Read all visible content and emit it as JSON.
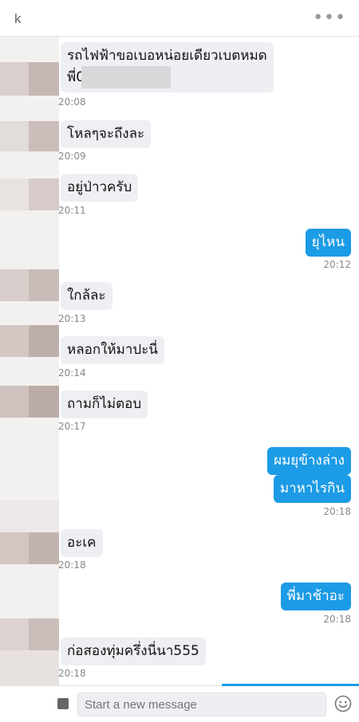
{
  "header": {
    "name": "k",
    "more_icon": "•••"
  },
  "messages": [
    {
      "dir": "in",
      "line1": "รถไฟฟ้าขอเบอหน่อยเดียวเบตหมด",
      "line2": "พี่0",
      "time": "20:08"
    },
    {
      "dir": "in",
      "text": "โหลๆจะถึงละ",
      "time": "20:09"
    },
    {
      "dir": "in",
      "text": "อยู่ป่าวครับ",
      "time": "20:11"
    },
    {
      "dir": "out",
      "text": "ยุไหน",
      "time": "20:12"
    },
    {
      "dir": "in",
      "text": "ใกล้ละ",
      "time": "20:13"
    },
    {
      "dir": "in",
      "text": "หลอกให้มาปะนี่",
      "time": "20:14"
    },
    {
      "dir": "in",
      "text": "ถามก็ไม่ตอบ",
      "time": "20:17"
    },
    {
      "dir": "out",
      "text": "ผมยุข้างล่าง",
      "time": ""
    },
    {
      "dir": "out",
      "text": "มาหาไรกิน",
      "time": "20:18"
    },
    {
      "dir": "in",
      "text": "อะเค",
      "time": "20:18"
    },
    {
      "dir": "out",
      "text": "พี่มาช้าอะ",
      "time": "20:18"
    },
    {
      "dir": "in",
      "text": "ก่อสองทุ่มครึ่งนี่นา555",
      "time": "20:18"
    }
  ],
  "composer": {
    "placeholder": "Start a new message",
    "attach_icon": "attachment-icon",
    "emoji_icon": "emoji-icon"
  },
  "colors": {
    "outgoing_bubble": "#1c9be6",
    "incoming_bubble": "#eeeff3"
  }
}
